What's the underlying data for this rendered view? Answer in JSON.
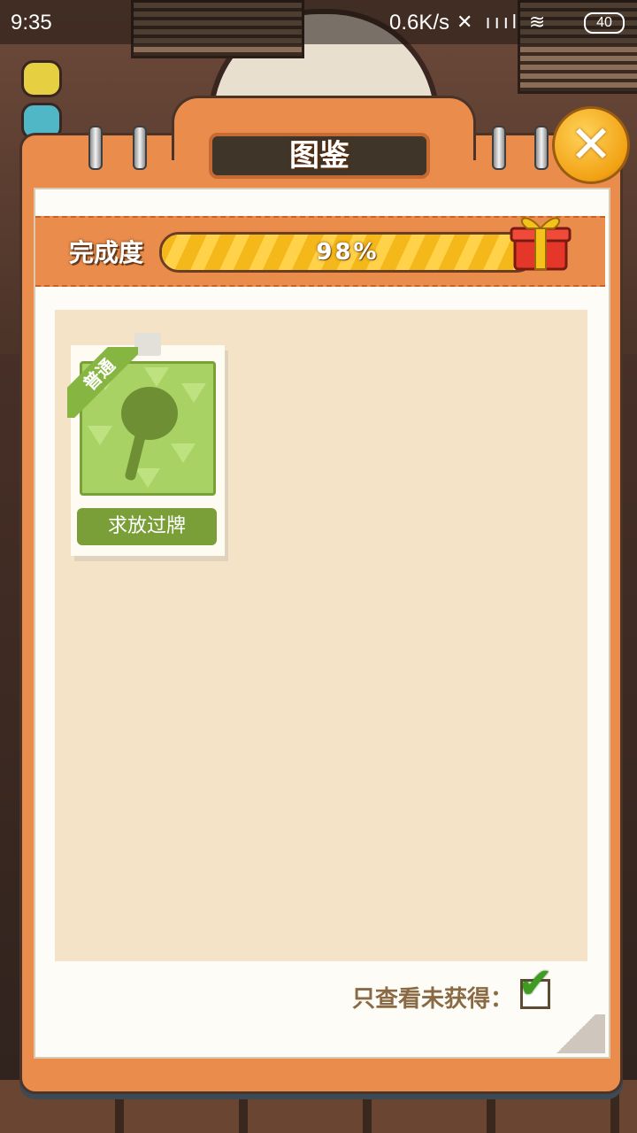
{
  "status_bar": {
    "time": "9:35",
    "speed": "0.6K/s",
    "icons": "✕ ıııl ≋",
    "battery": "40"
  },
  "panel": {
    "title": "图鉴",
    "close_icon": "✕"
  },
  "progress": {
    "label": "完成度",
    "value_text": "98%",
    "fraction": 0.98
  },
  "cards": [
    {
      "ribbon": "普通",
      "button": "求放过牌",
      "icon": "paddle-icon"
    }
  ],
  "filter": {
    "label": "只查看未获得：",
    "checked": true,
    "check_glyph": "✔"
  },
  "colors": {
    "panel_orange": "#ea8d4c",
    "progress_yellow": "#f4b81a",
    "card_green": "#a8d364",
    "button_green": "#7a9e38",
    "content_bg": "#f4e3c6"
  }
}
